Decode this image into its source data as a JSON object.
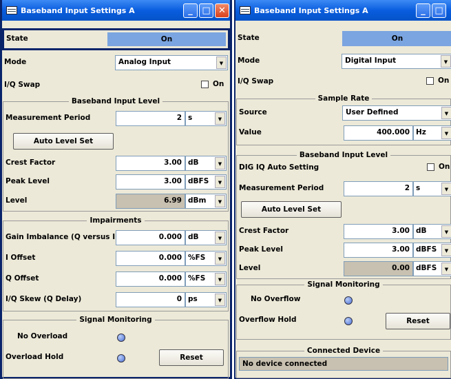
{
  "left": {
    "title": "Baseband Input Settings  A",
    "state_label": "State",
    "state_value": "On",
    "mode_label": "Mode",
    "mode_value": "Analog Input",
    "iqswap_label": "I/Q Swap",
    "iqswap_on": "On",
    "bil": {
      "title": "Baseband Input Level",
      "meas_label": "Measurement Period",
      "meas_value": "2",
      "meas_unit": "s",
      "auto_btn": "Auto Level Set",
      "crest_label": "Crest Factor",
      "crest_value": "3.00",
      "crest_unit": "dB",
      "peak_label": "Peak Level",
      "peak_value": "3.00",
      "peak_unit": "dBFS",
      "level_label": "Level",
      "level_value": "6.99",
      "level_unit": "dBm"
    },
    "imp": {
      "title": "Impairments",
      "gain_label": "Gain Imbalance (Q versus I)",
      "gain_value": "0.000",
      "gain_unit": "dB",
      "ioff_label": "I Offset",
      "ioff_value": "0.000",
      "ioff_unit": "%FS",
      "qoff_label": "Q Offset",
      "qoff_value": "0.000",
      "qoff_unit": "%FS",
      "skew_label": "I/Q Skew (Q Delay)",
      "skew_value": "0",
      "skew_unit": "ps"
    },
    "sig": {
      "title": "Signal Monitoring",
      "no_label": "No Overload",
      "hold_label": "Overload Hold",
      "reset_btn": "Reset"
    }
  },
  "right": {
    "title": "Baseband Input Settings  A",
    "state_label": "State",
    "state_value": "On",
    "mode_label": "Mode",
    "mode_value": "Digital Input",
    "iqswap_label": "I/Q Swap",
    "iqswap_on": "On",
    "sr": {
      "title": "Sample Rate",
      "source_label": "Source",
      "source_value": "User Defined",
      "value_label": "Value",
      "value_value": "400.000",
      "value_unit": "Hz"
    },
    "bil": {
      "title": "Baseband Input Level",
      "dig_label": "DIG IQ Auto Setting",
      "dig_on": "On",
      "meas_label": "Measurement Period",
      "meas_value": "2",
      "meas_unit": "s",
      "auto_btn": "Auto Level Set",
      "crest_label": "Crest Factor",
      "crest_value": "3.00",
      "crest_unit": "dB",
      "peak_label": "Peak Level",
      "peak_value": "3.00",
      "peak_unit": "dBFS",
      "level_label": "Level",
      "level_value": "0.00",
      "level_unit": "dBFS"
    },
    "sig": {
      "title": "Signal Monitoring",
      "no_label": "No Overflow",
      "hold_label": "Overflow Hold",
      "reset_btn": "Reset"
    },
    "conn": {
      "title": "Connected Device",
      "message": "No device connected"
    }
  },
  "window_controls": {
    "minimize": "_",
    "maximize": "□",
    "close": "✕"
  },
  "icons": {
    "window": "window-icon",
    "dropdown": "chevron-down-icon",
    "led": "led-indicator-icon",
    "checkbox": "checkbox-icon"
  },
  "colors": {
    "title_bar": "#0a5ddf",
    "state_on": "#7ba5e0",
    "led": "#4a70d8",
    "readonly": "#c8c0b0"
  }
}
